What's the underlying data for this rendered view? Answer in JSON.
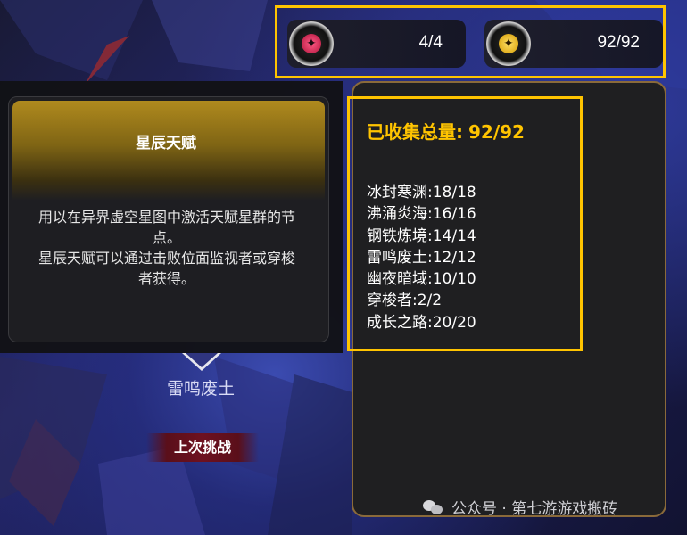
{
  "resources": {
    "left": {
      "icon": "pink-star-emblem-icon",
      "value": "4/4",
      "color": "#e8305a"
    },
    "right": {
      "icon": "gold-star-emblem-icon",
      "value": "92/92",
      "color": "#ffd21a"
    }
  },
  "tooltip": {
    "title": "星辰天赋",
    "description_line1": "用以在异界虚空星图中激活天赋星群的节",
    "description_line2": "点。",
    "description_line3": "星辰天赋可以通过击败位面监视者或穿梭",
    "description_line4": "者获得。"
  },
  "map_node": {
    "name": "雷鸣废土",
    "challenge_label": "上次挑战"
  },
  "stats": {
    "total_label": "已收集总量:",
    "total_value": "92/92",
    "rows": [
      "冰封寒渊:18/18",
      "沸涌炎海:16/16",
      "钢铁炼境:14/14",
      "雷鸣废土:12/12",
      "幽夜暗域:10/10",
      "穿梭者:2/2",
      "成长之路:20/20"
    ]
  },
  "watermark": {
    "text": "公众号 · 第七游游戏搬砖",
    "icon": "wechat-icon"
  },
  "colors": {
    "highlight": "#ffc400",
    "panel_border": "#8a6a3a"
  }
}
